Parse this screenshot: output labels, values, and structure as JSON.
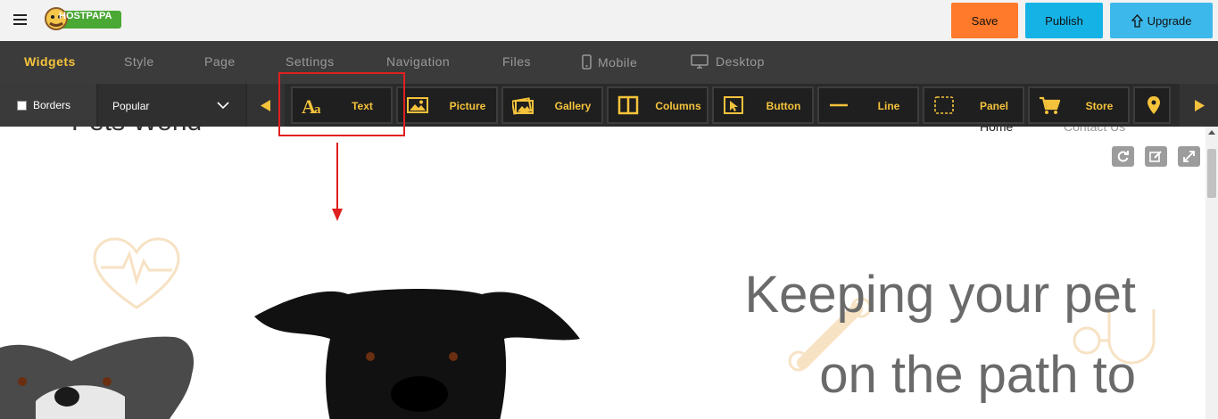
{
  "topbar": {
    "logo_text": "HOSTPAPA",
    "save_label": "Save",
    "publish_label": "Publish",
    "upgrade_label": "Upgrade"
  },
  "menu": {
    "items": [
      "Widgets",
      "Style",
      "Page",
      "Settings",
      "Navigation",
      "Files",
      "Mobile",
      "Desktop"
    ],
    "active": "Widgets"
  },
  "widgetbar": {
    "borders_label": "Borders",
    "category_selected": "Popular",
    "widgets": [
      {
        "label": "Text",
        "icon": "text-icon"
      },
      {
        "label": "Picture",
        "icon": "picture-icon"
      },
      {
        "label": "Gallery",
        "icon": "gallery-icon"
      },
      {
        "label": "Columns",
        "icon": "columns-icon"
      },
      {
        "label": "Button",
        "icon": "button-icon"
      },
      {
        "label": "Line",
        "icon": "line-icon"
      },
      {
        "label": "Panel",
        "icon": "panel-icon"
      },
      {
        "label": "Store",
        "icon": "store-icon"
      },
      {
        "label": "",
        "icon": "map-pin-icon"
      }
    ]
  },
  "canvas": {
    "site_title": "Pets World",
    "nav": [
      "Home",
      "Contact Us"
    ],
    "hero_line1": "Keeping your pet",
    "hero_line2": "on the path to"
  },
  "colors": {
    "accent": "#f5c33b",
    "save": "#ff7a2a",
    "publish": "#15b2e6",
    "upgrade": "#3db8ea",
    "highlight": "#e02020"
  }
}
